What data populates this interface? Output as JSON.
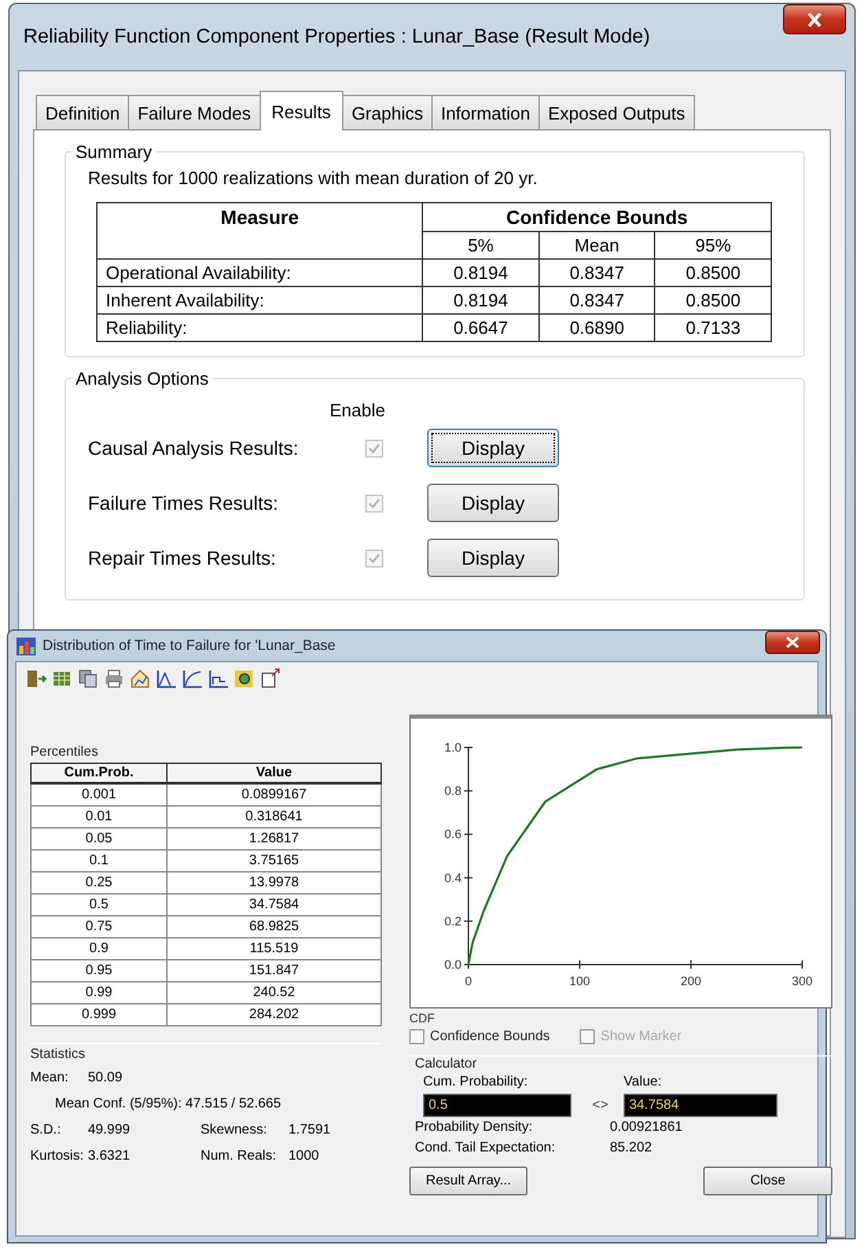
{
  "window": {
    "title": "Reliability Function Component Properties : Lunar_Base (Result Mode)"
  },
  "tabs": [
    {
      "label": "Definition",
      "selected": false
    },
    {
      "label": "Failure Modes",
      "selected": false
    },
    {
      "label": "Results",
      "selected": true
    },
    {
      "label": "Graphics",
      "selected": false
    },
    {
      "label": "Information",
      "selected": false
    },
    {
      "label": "Exposed Outputs",
      "selected": false
    }
  ],
  "summary": {
    "title": "Summary",
    "text": "Results for 1000 realizations with mean duration of 20 yr.",
    "table": {
      "measure_header": "Measure",
      "bounds_header": "Confidence Bounds",
      "subheaders": [
        "5%",
        "Mean",
        "95%"
      ],
      "rows": [
        {
          "label": "Operational Availability:",
          "values": [
            "0.8194",
            "0.8347",
            "0.8500"
          ]
        },
        {
          "label": "Inherent Availability:",
          "values": [
            "0.8194",
            "0.8347",
            "0.8500"
          ]
        },
        {
          "label": "Reliability:",
          "values": [
            "0.6647",
            "0.6890",
            "0.7133"
          ]
        }
      ]
    }
  },
  "analysis_options": {
    "title": "Analysis Options",
    "enable_header": "Enable",
    "rows": [
      {
        "label": "Causal Analysis Results:",
        "checked": true,
        "disabled": true,
        "button": "Display",
        "focused": true
      },
      {
        "label": "Failure Times Results:",
        "checked": true,
        "disabled": true,
        "button": "Display",
        "focused": false
      },
      {
        "label": "Repair Times Results:",
        "checked": true,
        "disabled": true,
        "button": "Display",
        "focused": false
      }
    ]
  },
  "distribution_dialog": {
    "title": "Distribution of Time to Failure for 'Lunar_Base",
    "percentiles": {
      "title": "Percentiles",
      "columns": [
        "Cum.Prob.",
        "Value"
      ],
      "rows": [
        [
          "0.001",
          "0.0899167"
        ],
        [
          "0.01",
          "0.318641"
        ],
        [
          "0.05",
          "1.26817"
        ],
        [
          "0.1",
          "3.75165"
        ],
        [
          "0.25",
          "13.9978"
        ],
        [
          "0.5",
          "34.7584"
        ],
        [
          "0.75",
          "68.9825"
        ],
        [
          "0.9",
          "115.519"
        ],
        [
          "0.95",
          "151.847"
        ],
        [
          "0.99",
          "240.52"
        ],
        [
          "0.999",
          "284.202"
        ]
      ]
    },
    "statistics": {
      "title": "Statistics",
      "mean_label": "Mean:",
      "mean": "50.09",
      "mean_conf": "Mean Conf. (5/95%): 47.515 / 52.665",
      "sd_label": "S.D.:",
      "sd": "49.999",
      "skewness_label": "Skewness:",
      "skewness": "1.7591",
      "kurtosis_label": "Kurtosis:",
      "kurtosis": "3.6321",
      "num_reals_label": "Num. Reals:",
      "num_reals": "1000"
    },
    "chart": {
      "chart_data": {
        "type": "line",
        "xlabel": "CDF",
        "x": [
          0,
          3.75,
          14,
          34.76,
          68.98,
          115.52,
          151.85,
          240.52,
          284.2,
          300
        ],
        "series": [
          {
            "color": "#1e7a1e",
            "values": [
              0,
              0.1,
              0.25,
              0.5,
              0.75,
              0.9,
              0.95,
              0.99,
              0.999,
              1.0
            ]
          }
        ],
        "xlim": [
          0,
          300
        ],
        "ylim": [
          0,
          1
        ],
        "xticks": [
          0,
          100,
          200,
          300
        ],
        "yticks": [
          {
            "value": 0,
            "label": "0.0"
          },
          {
            "value": 0.2,
            "label": "0.2"
          },
          {
            "value": 0.4,
            "label": "0.4"
          },
          {
            "value": 0.6,
            "label": "0.6"
          },
          {
            "value": 0.8,
            "label": "0.8"
          },
          {
            "value": 1,
            "label": "1.0"
          }
        ]
      }
    },
    "options": [
      {
        "label": "Confidence Bounds",
        "checked": false,
        "disabled": false
      },
      {
        "label": "Show Marker",
        "checked": false,
        "disabled": true
      }
    ],
    "calculator": {
      "title": "Calculator",
      "prob_label": "Cum. Probability:",
      "prob_value": "0.5",
      "swap": "<>",
      "value_label": "Value:",
      "value": "34.7584",
      "density_label": "Probability Density:",
      "density": "0.00921861",
      "tail_label": "Cond. Tail Expectation:",
      "tail": "85.202"
    },
    "buttons": {
      "result_array": "Result Array...",
      "close": "Close"
    }
  }
}
